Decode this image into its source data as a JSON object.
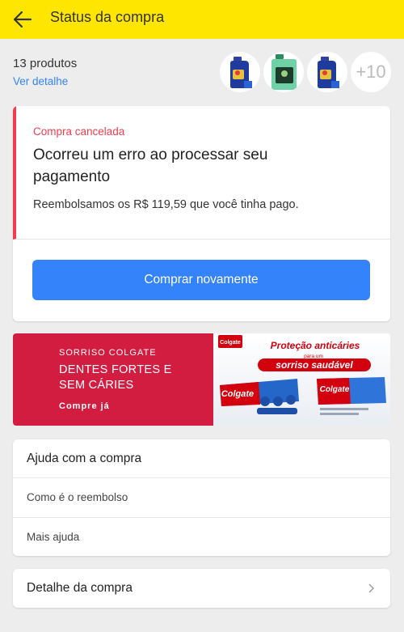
{
  "header": {
    "title": "Status da compra",
    "background": "#ffe600"
  },
  "products": {
    "count_label": "13 produtos",
    "detail_link": "Ver detalhe",
    "more_label": "+10"
  },
  "order_card": {
    "status": "Compra cancelada",
    "headline": "Ocorreu um erro ao processar seu pagamento",
    "refund_text": "Reembolsamos os R$ 119,59 que você tinha pago.",
    "button_label": "Comprar novamente",
    "status_color": "#f23d4f",
    "accent": "#3483fa"
  },
  "banner": {
    "kicker": "SORRISO COLGATE",
    "title_line1": "DENTES FORTES E",
    "title_line2": "SEM CÁRIES",
    "cta": "Compre já",
    "brand": "Colgate",
    "promo_line1": "Proteção anticáries",
    "promo_line2": "para um",
    "promo_line3": "sorriso saudável",
    "background": "#d31d40"
  },
  "help": {
    "title": "Ajuda com a compra",
    "items": [
      {
        "label": "Como é o reembolso"
      },
      {
        "label": "Mais ajuda"
      }
    ]
  },
  "detail": {
    "label": "Detalhe da compra"
  }
}
